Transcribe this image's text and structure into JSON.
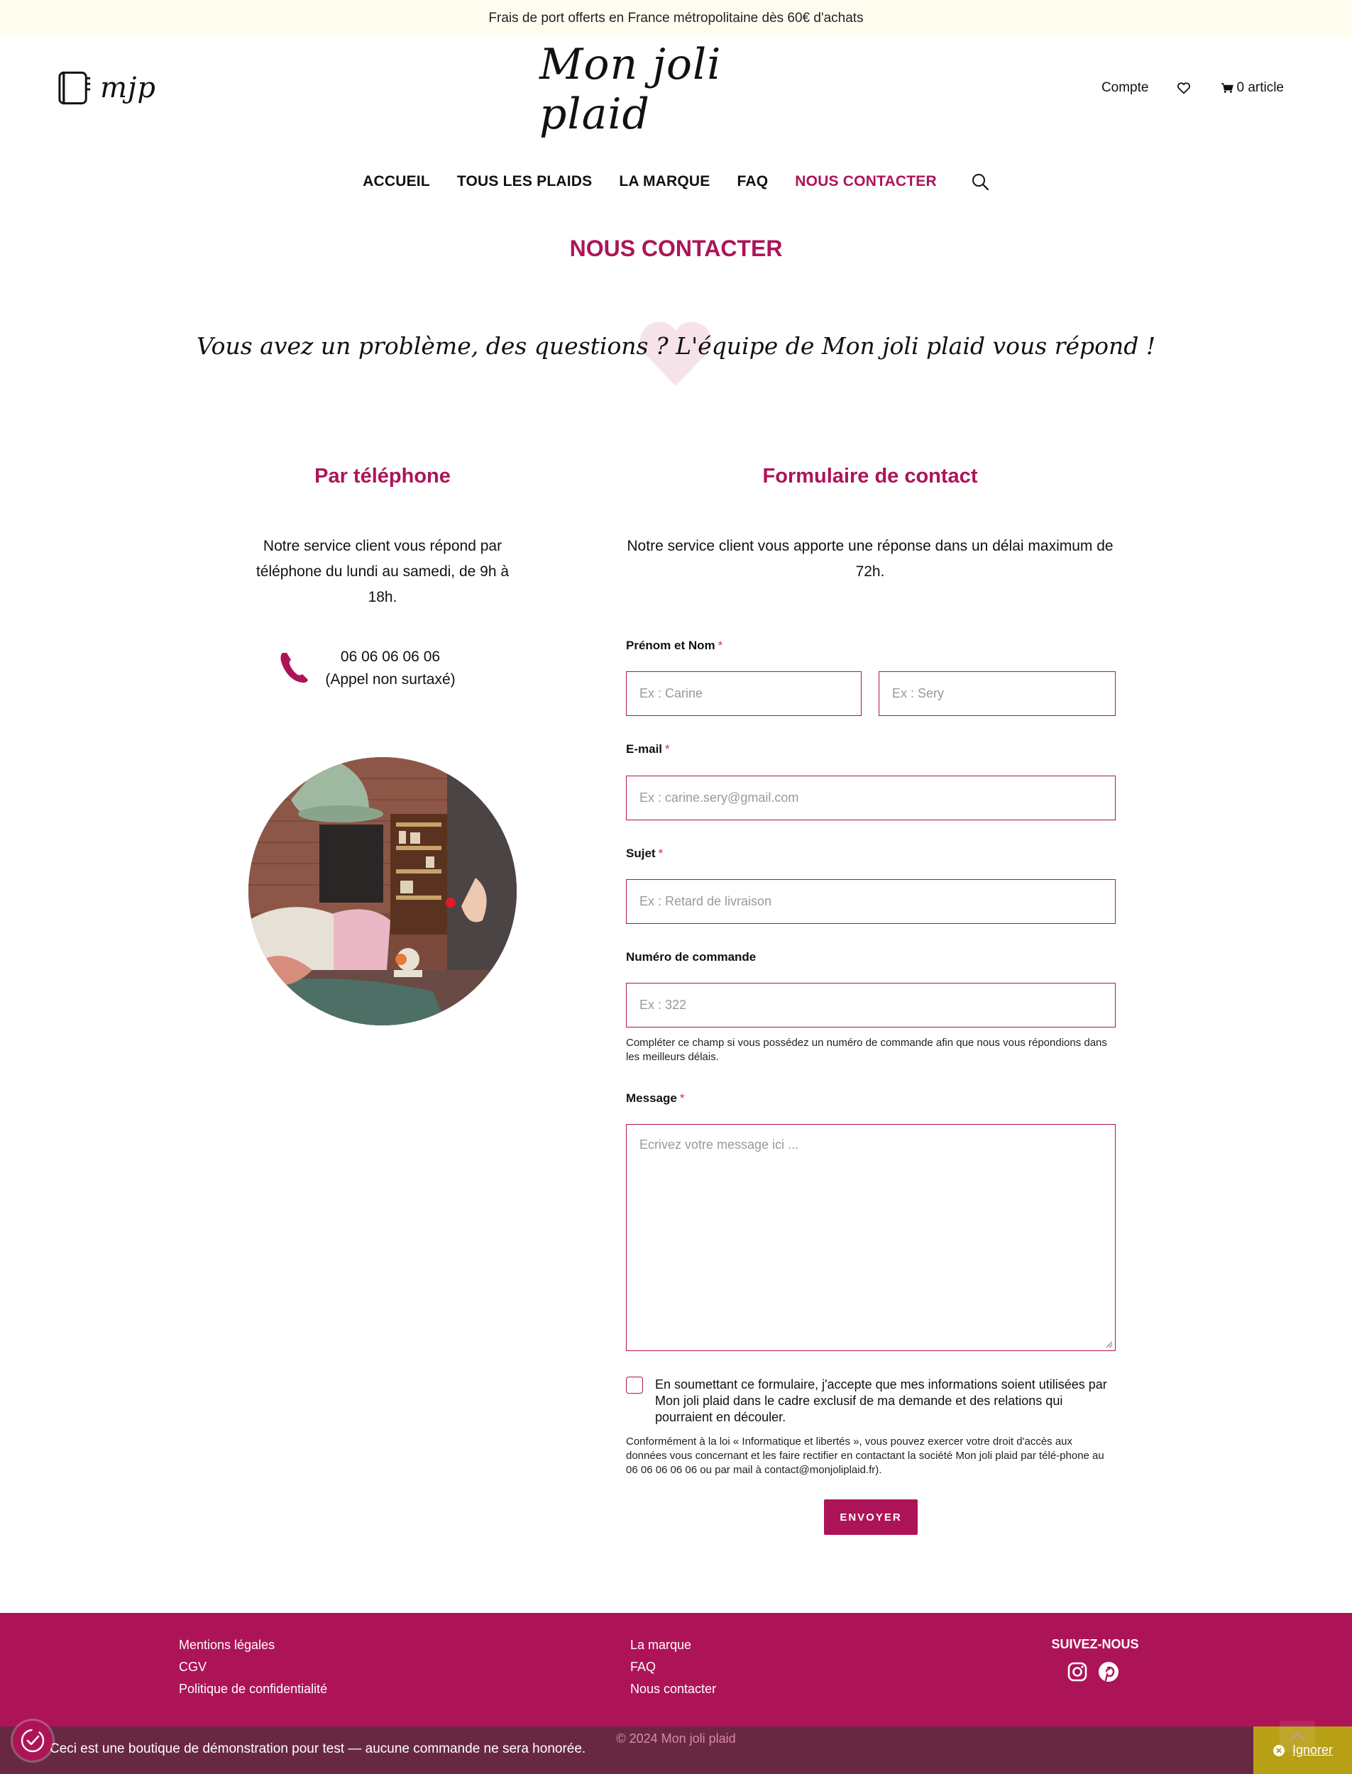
{
  "announcement": "Frais de port offerts en France métropolitaine dès 60€ d'achats",
  "header": {
    "logo_text": "mjp",
    "brand": "Mon joli plaid",
    "account": "Compte",
    "cart": "0 article"
  },
  "nav": {
    "items": [
      "ACCUEIL",
      "TOUS LES PLAIDS",
      "LA MARQUE",
      "FAQ",
      "NOUS CONTACTER"
    ],
    "active": "NOUS CONTACTER"
  },
  "page_title": "NOUS CONTACTER",
  "tagline": "Vous avez un problème, des questions ? L'équipe de Mon joli plaid vous répond !",
  "phone_section": {
    "title": "Par téléphone",
    "text": "Notre service client vous répond par téléphone du lundi au samedi, de 9h à 18h.",
    "number": "06 06 06 06 06",
    "note": "(Appel non surtaxé)"
  },
  "form": {
    "title": "Formulaire de contact",
    "intro": "Notre service client vous apporte une réponse dans un délai maximum de 72h.",
    "name_label": "Prénom et Nom",
    "firstname_placeholder": "Ex : Carine",
    "lastname_placeholder": "Ex : Sery",
    "email_label": "E-mail",
    "email_placeholder": "Ex : carine.sery@gmail.com",
    "subject_label": "Sujet",
    "subject_placeholder": "Ex : Retard de livraison",
    "order_label": "Numéro de commande",
    "order_placeholder": "Ex : 322",
    "order_hint": "Compléter ce champ si vous possédez un numéro de commande afin que nous vous répondions dans les meilleurs délais.",
    "message_label": "Message",
    "message_placeholder": "Ecrivez votre message ici ...",
    "consent": "En soumettant ce formulaire, j'accepte que mes informations soient utilisées par Mon joli plaid dans le cadre exclusif de ma demande et des relations qui pourraient en découler.",
    "legal": "Conformément à la loi « Informatique et libertés », vous pouvez exercer votre droit d'accès aux données vous concernant et les faire rectifier en contactant la société Mon joli plaid par télé-phone au 06 06 06 06 06 ou par mail à contact@monjoliplaid.fr).",
    "submit": "ENVOYER",
    "required_mark": "*"
  },
  "footer": {
    "col1": [
      "Mentions légales",
      "CGV",
      "Politique de confidentialité"
    ],
    "col2": [
      "La marque",
      "FAQ",
      "Nous contacter"
    ],
    "follow": "SUIVEZ-NOUS",
    "copyright": "© 2024 Mon joli plaid"
  },
  "demo_bar": {
    "text": "Ceci est une boutique de démonstration pour test — aucune commande ne sera honorée.",
    "dismiss": "Ignorer"
  },
  "colors": {
    "accent": "#ad1457",
    "announcement_bg": "#fffdf0",
    "dismiss_bg": "#b8a016"
  }
}
